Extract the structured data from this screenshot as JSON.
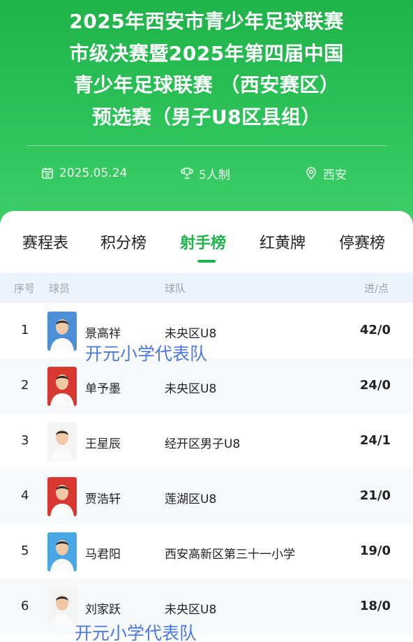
{
  "header": {
    "title_lines": [
      "2025年西安市青少年足球联赛",
      "市级决赛暨2025年第四届中国",
      "青少年足球联赛 （西安赛区）",
      "预选赛（男子U8区县组）"
    ],
    "date": "2025.05.24",
    "format": "5人制",
    "location": "西安"
  },
  "tabs": [
    {
      "label": "赛程表",
      "active": false
    },
    {
      "label": "积分榜",
      "active": false
    },
    {
      "label": "射手榜",
      "active": true
    },
    {
      "label": "红黄牌",
      "active": false
    },
    {
      "label": "停赛榜",
      "active": false
    }
  ],
  "table": {
    "columns": [
      "序号",
      "球员",
      "球队",
      "进/点"
    ],
    "rows": [
      {
        "rank": "1",
        "player": "景高祥",
        "team": "未央区U8",
        "score": "42/0",
        "avatar_bg": "#4d8fd6"
      },
      {
        "rank": "2",
        "player": "单予墨",
        "team": "未央区U8",
        "score": "24/0",
        "avatar_bg": "#d8382f"
      },
      {
        "rank": "3",
        "player": "王星辰",
        "team": "经开区男子U8",
        "score": "24/1",
        "avatar_bg": "#f4f4f4"
      },
      {
        "rank": "4",
        "player": "贾浩轩",
        "team": "莲湖区U8",
        "score": "21/0",
        "avatar_bg": "#d8382f"
      },
      {
        "rank": "5",
        "player": "马君阳",
        "team": "西安高新区第三十一小学",
        "score": "19/0",
        "avatar_bg": "#4aa7e6"
      },
      {
        "rank": "6",
        "player": "刘家跃",
        "team": "未央区U8",
        "score": "18/0",
        "avatar_bg": "#f4f4f4"
      }
    ]
  },
  "overlays": [
    "开元小学代表队",
    "开元小学代表队"
  ],
  "colors": {
    "accent": "#1fb34a",
    "overlay_text": "#4a78e0",
    "table_header_bg": "#eef3fb"
  }
}
